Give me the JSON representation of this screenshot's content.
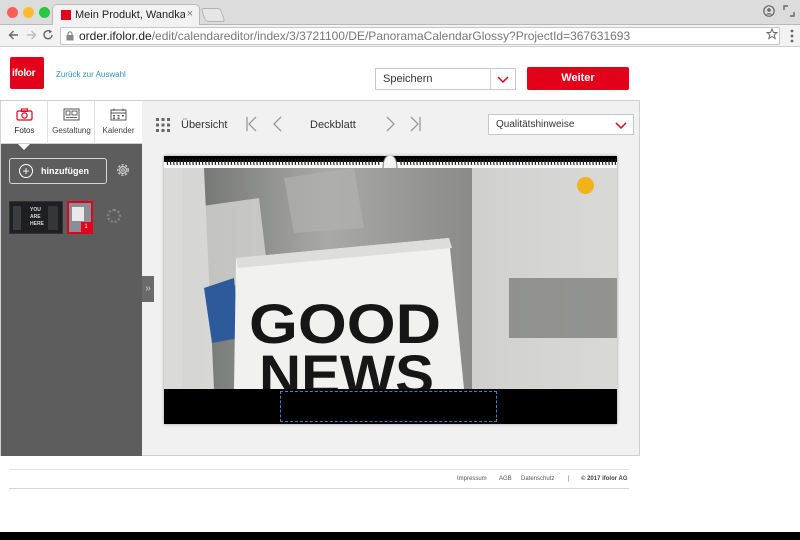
{
  "browser": {
    "tab_title": "Mein Produkt, Wandkalender Gl",
    "tab_close": "×",
    "url_host": "order.ifolor.de",
    "url_path": "/edit/calendareditor/index/3/3721100/DE/PanoramaCalendarGlossy?ProjectId=367631693"
  },
  "header": {
    "logo_text": "ifolor",
    "back_link": "Zurück zur Auswahl",
    "save_select_value": "Speichern",
    "next_button": "Weiter",
    "accent_color": "#e3001b",
    "link_color": "#2f8fc4"
  },
  "sidebar": {
    "tabs": [
      {
        "label": "Fotos",
        "icon": "camera-icon",
        "active": true
      },
      {
        "label": "Gestaltung",
        "icon": "layout-icon",
        "active": false
      },
      {
        "label": "Kalender",
        "icon": "calendar-icon",
        "active": false
      }
    ],
    "add_button": "hinzufügen",
    "thumbnail_1_text": [
      "YOU",
      "ARE",
      "HERE"
    ],
    "thumbnail_2_badge": "1",
    "collapse_glyph": "»"
  },
  "toolbar": {
    "overview_label": "Übersicht",
    "page_name": "Deckblatt",
    "quality_select_value": "Qualitätshinweise"
  },
  "canvas": {
    "photo_text_line1": "GOOD",
    "photo_text_line2": "NEWS",
    "quality_indicator_color": "#f1b21c"
  },
  "footer": {
    "links": [
      "Impressum",
      "AGB",
      "Datenschutz"
    ],
    "divider": "|",
    "copyright": "© 2017 ifolor AG"
  }
}
